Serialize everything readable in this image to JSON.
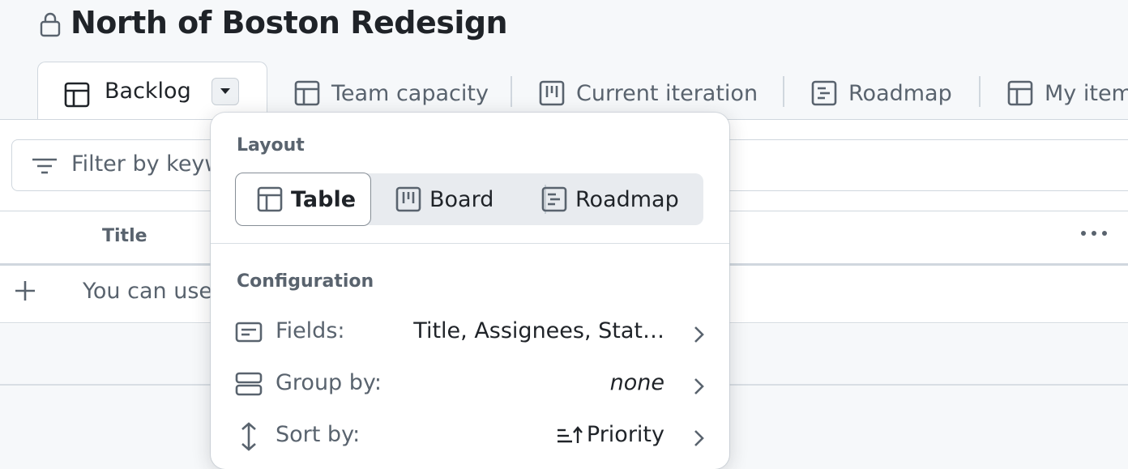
{
  "project": {
    "title": "North of Boston Redesign",
    "visibility_icon": "lock-icon"
  },
  "tabs": [
    {
      "label": "Backlog",
      "icon": "table-icon",
      "active": true
    },
    {
      "label": "Team capacity",
      "icon": "table-icon"
    },
    {
      "label": "Current iteration",
      "icon": "board-icon"
    },
    {
      "label": "Roadmap",
      "icon": "roadmap-icon"
    },
    {
      "label": "My item",
      "icon": "table-icon"
    }
  ],
  "filter": {
    "placeholder": "Filter by keyw"
  },
  "table": {
    "header_title": "Title",
    "add_hint": "You can use"
  },
  "view_menu": {
    "layout_label": "Layout",
    "layouts": [
      {
        "label": "Table",
        "icon": "table-icon",
        "selected": true
      },
      {
        "label": "Board",
        "icon": "board-icon"
      },
      {
        "label": "Roadmap",
        "icon": "roadmap-icon"
      }
    ],
    "configuration_label": "Configuration",
    "fields": {
      "label": "Fields:",
      "value": "Title, Assignees, Stat…"
    },
    "group_by": {
      "label": "Group by:",
      "value": "none"
    },
    "sort_by": {
      "label": "Sort by:",
      "value": "Priority",
      "direction_icon": "sort-ascending-icon"
    }
  },
  "colors": {
    "text": "#1f2328",
    "muted": "#59636e",
    "border": "#d0d7de",
    "canvas": "#f6f8fa"
  }
}
